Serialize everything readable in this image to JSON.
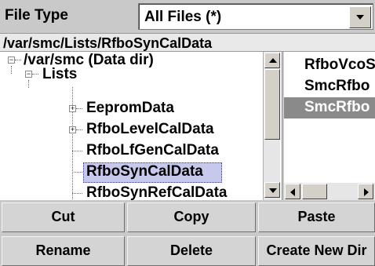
{
  "file_type": {
    "label": "File Type",
    "selected": "All Files (*)"
  },
  "path": "/var/smc/Lists/RfboSynCalData",
  "tree": {
    "nodes": [
      {
        "label": "/var/smc (Data dir)",
        "expanded": true
      },
      {
        "label": "Lists",
        "expanded": true
      },
      {
        "label": "EepromData",
        "expanded": false
      },
      {
        "label": "RfboLevelCalData",
        "expanded": false
      },
      {
        "label": "RfboLfGenCalData"
      },
      {
        "label": "RfboSynCalData",
        "selected": true
      },
      {
        "label": "RfboSynRefCalData"
      }
    ]
  },
  "files": [
    {
      "label": "RfboVcoS"
    },
    {
      "label": "SmcRfbo"
    },
    {
      "label": "SmcRfbo",
      "selected": true
    }
  ],
  "buttons": {
    "cut": "Cut",
    "copy": "Copy",
    "paste": "Paste",
    "rename": "Rename",
    "delete": "Delete",
    "create_new_dir": "Create New Dir"
  }
}
